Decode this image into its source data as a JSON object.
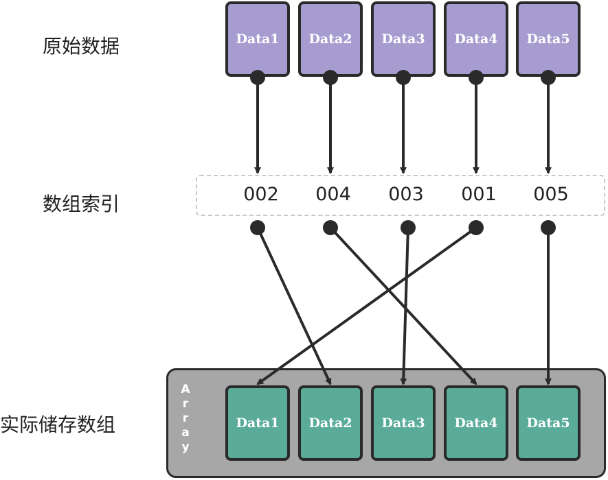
{
  "labels": {
    "source": "原始数据",
    "index": "数组索引",
    "storage": "实际储存数组",
    "array": "Array"
  },
  "source_items": [
    "Data1",
    "Data2",
    "Data3",
    "Data4",
    "Data5"
  ],
  "index_items": [
    "002",
    "004",
    "003",
    "001",
    "005"
  ],
  "storage_items": [
    "Data1",
    "Data2",
    "Data3",
    "Data4",
    "Data5"
  ],
  "mapping": [
    {
      "from_index_slot": 0,
      "to_storage_slot": 1
    },
    {
      "from_index_slot": 1,
      "to_storage_slot": 3
    },
    {
      "from_index_slot": 2,
      "to_storage_slot": 2
    },
    {
      "from_index_slot": 3,
      "to_storage_slot": 0
    },
    {
      "from_index_slot": 4,
      "to_storage_slot": 4
    }
  ],
  "colors": {
    "source_fill": "#a79ccf",
    "storage_fill": "#5aab98",
    "container_fill": "#a7a7a7",
    "line": "#2a2a2a"
  }
}
